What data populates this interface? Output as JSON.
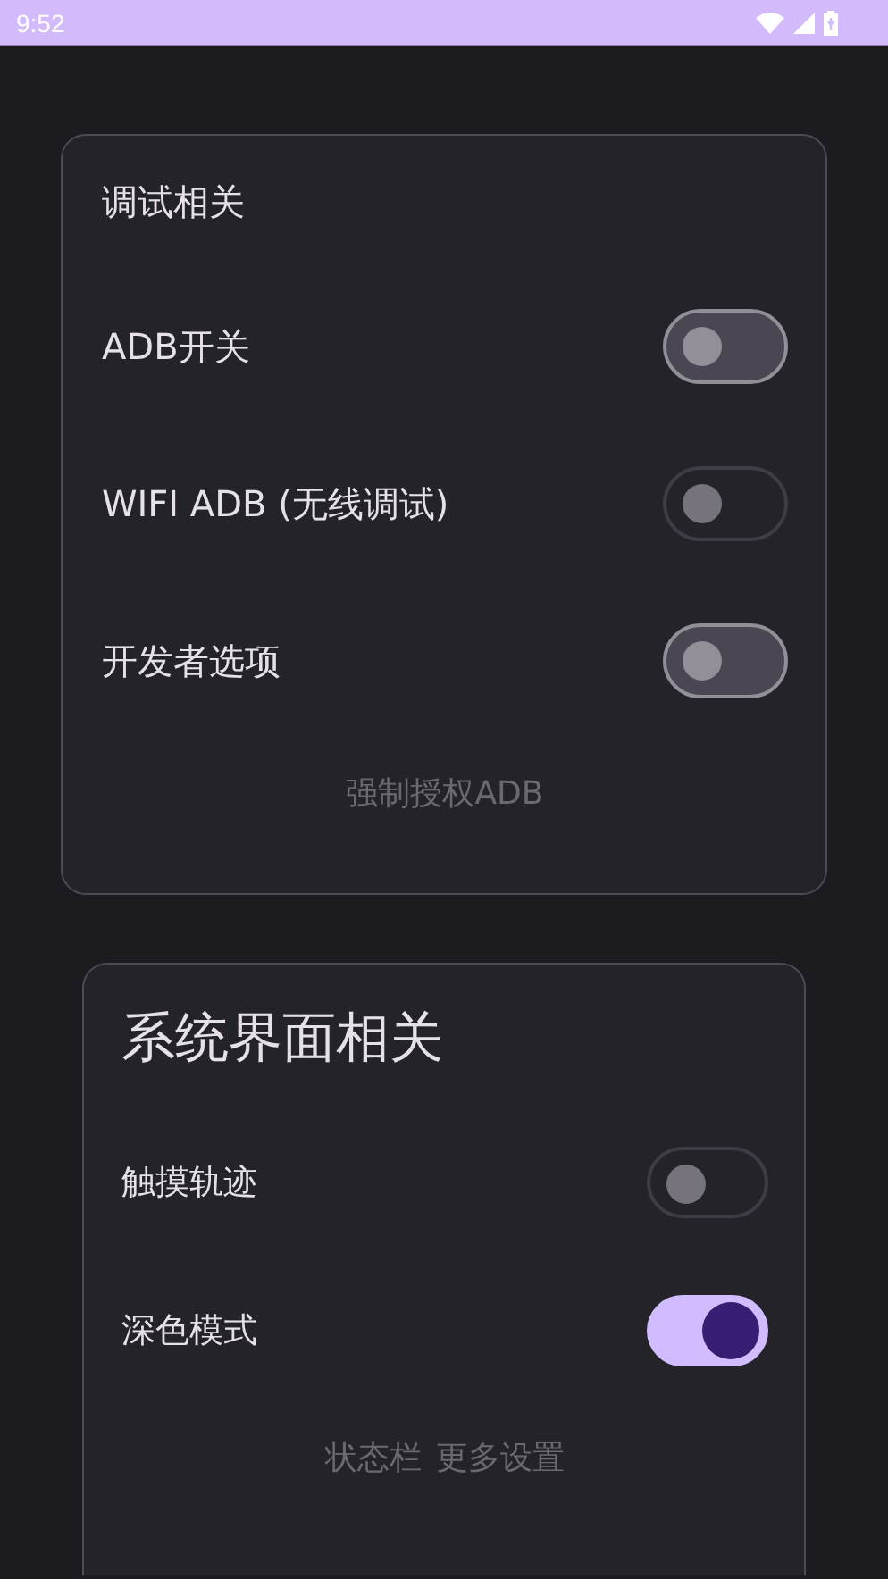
{
  "status_bar": {
    "time": "9:52"
  },
  "cards": [
    {
      "title": "调试相关",
      "rows": [
        {
          "label": "ADB开关",
          "on": false,
          "disabled": false
        },
        {
          "label": "WIFI ADB (无线调试)",
          "on": false,
          "disabled": true
        },
        {
          "label": "开发者选项",
          "on": false,
          "disabled": false
        }
      ],
      "actions": [
        "强制授权ADB"
      ]
    },
    {
      "title": "系统界面相关",
      "rows": [
        {
          "label": "触摸轨迹",
          "on": false,
          "disabled": true
        },
        {
          "label": "深色模式",
          "on": true,
          "disabled": false
        }
      ],
      "actions": [
        "状态栏",
        "更多设置"
      ]
    }
  ]
}
